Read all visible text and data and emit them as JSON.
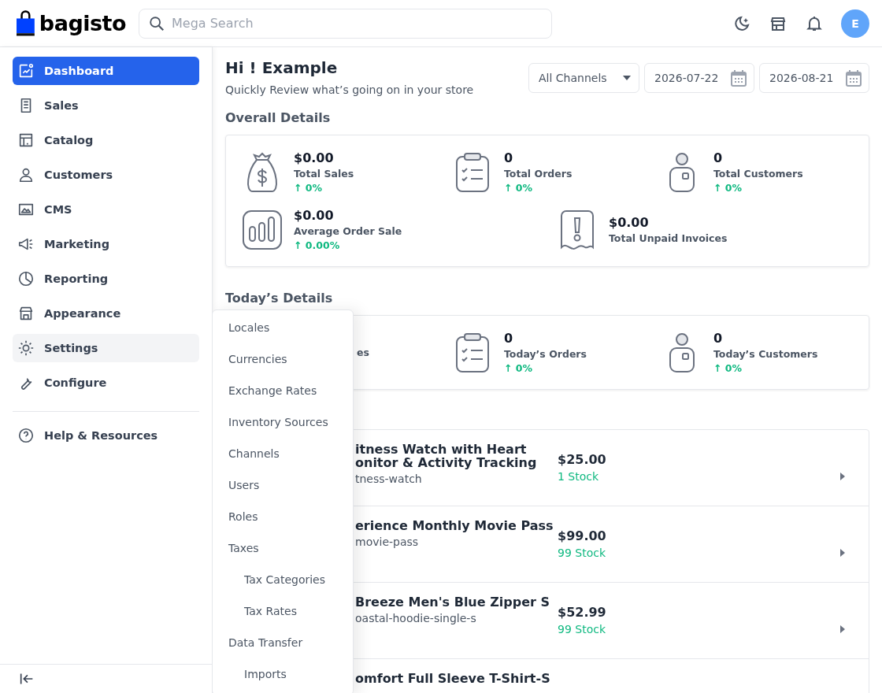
{
  "logo": {
    "text": "bagisto"
  },
  "search": {
    "placeholder": "Mega Search"
  },
  "avatar": {
    "initial": "E"
  },
  "sidebar": {
    "items": [
      {
        "label": "Dashboard",
        "selected": true,
        "hovered": false
      },
      {
        "label": "Sales",
        "selected": false,
        "hovered": false
      },
      {
        "label": "Catalog",
        "selected": false,
        "hovered": false
      },
      {
        "label": "Customers",
        "selected": false,
        "hovered": false
      },
      {
        "label": "CMS",
        "selected": false,
        "hovered": false
      },
      {
        "label": "Marketing",
        "selected": false,
        "hovered": false
      },
      {
        "label": "Reporting",
        "selected": false,
        "hovered": false
      },
      {
        "label": "Appearance",
        "selected": false,
        "hovered": false
      },
      {
        "label": "Settings",
        "selected": false,
        "hovered": true
      },
      {
        "label": "Configure",
        "selected": false,
        "hovered": false
      }
    ],
    "help": {
      "label": "Help & Resources"
    }
  },
  "settings_menu": {
    "items": [
      {
        "label": "Locales"
      },
      {
        "label": "Currencies"
      },
      {
        "label": "Exchange Rates"
      },
      {
        "label": "Inventory Sources"
      },
      {
        "label": "Channels"
      },
      {
        "label": "Users"
      },
      {
        "label": "Roles"
      },
      {
        "label": "Taxes",
        "children": [
          {
            "label": "Tax Categories"
          },
          {
            "label": "Tax Rates"
          }
        ]
      },
      {
        "label": "Data Transfer",
        "children": [
          {
            "label": "Imports"
          }
        ]
      }
    ]
  },
  "greeting": {
    "title": "Hi ! Example",
    "subtitle": "Quickly Review what’s going on in your store"
  },
  "filters": {
    "channel": "All Channels",
    "start_date": "2026-07-22",
    "end_date": "2026-08-21"
  },
  "overall": {
    "title": "Overall Details",
    "rows": [
      [
        {
          "kind": "sales",
          "value": "$0.00",
          "label": "Total Sales",
          "change": "↑ 0%"
        },
        {
          "kind": "orders",
          "value": "0",
          "label": "Total Orders",
          "change": "↑ 0%"
        },
        {
          "kind": "customers",
          "value": "0",
          "label": "Total Customers",
          "change": "↑ 0%"
        }
      ],
      [
        {
          "kind": "average",
          "value": "$0.00",
          "label": "Average Order Sale",
          "change": "↑ 0.00%"
        },
        {
          "kind": "invoices",
          "value": "$0.00",
          "label": "Total Unpaid Invoices"
        }
      ]
    ]
  },
  "today": {
    "title": "Today’s Details",
    "stats": [
      {
        "label": "es"
      },
      {
        "kind": "orders",
        "value": "0",
        "label": "Today’s Orders",
        "change": "↑ 0%"
      },
      {
        "kind": "customers",
        "value": "0",
        "label": "Today’s Customers",
        "change": "↑ 0%"
      }
    ]
  },
  "products": [
    {
      "name": "itness Watch with Heart onitor & Activity Tracking",
      "slug": "tness-watch",
      "price": "$25.00",
      "stock": "1 Stock"
    },
    {
      "name": "erience Monthly Movie Pass",
      "slug": "movie-pass",
      "price": "$99.00",
      "stock": "99 Stock"
    },
    {
      "name": "Breeze Men's Blue Zipper S",
      "slug": "oastal-hoodie-single-s",
      "price": "$52.99",
      "stock": "99 Stock"
    },
    {
      "name": "omfort Full Sleeve T-Shirt-S"
    }
  ]
}
